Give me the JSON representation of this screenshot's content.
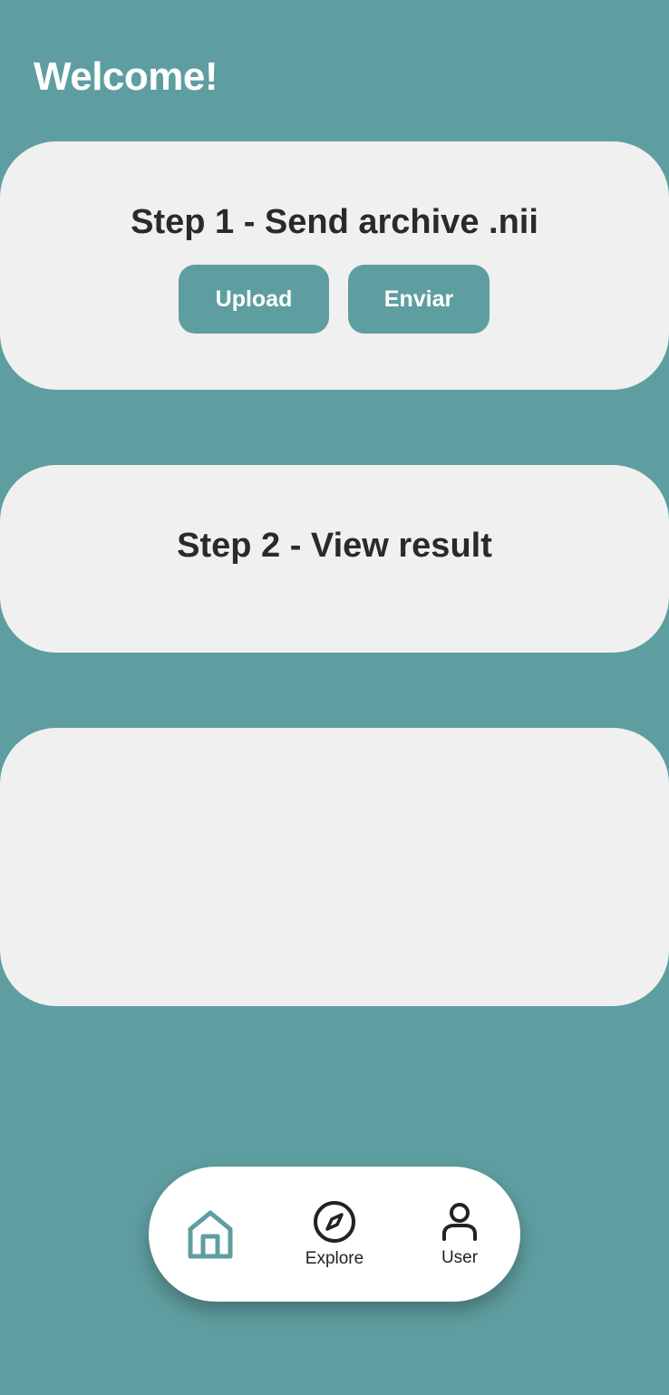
{
  "header": {
    "title": "Welcome!"
  },
  "step1": {
    "title": "Step 1 - Send archive .nii",
    "upload_label": "Upload",
    "send_label": "Enviar"
  },
  "step2": {
    "title": "Step 2 - View result"
  },
  "result_panel": {},
  "bottom_nav": {
    "items": [
      {
        "icon": "home-icon",
        "label": "",
        "active": true
      },
      {
        "icon": "compass-icon",
        "label": "Explore",
        "active": false
      },
      {
        "icon": "user-icon",
        "label": "User",
        "active": false
      }
    ]
  },
  "colors": {
    "background": "#5f9ea0",
    "card": "#f0f0f0",
    "accent": "#5f9ea0",
    "text_dark": "#2a2a2a",
    "nav_bg": "#ffffff"
  }
}
